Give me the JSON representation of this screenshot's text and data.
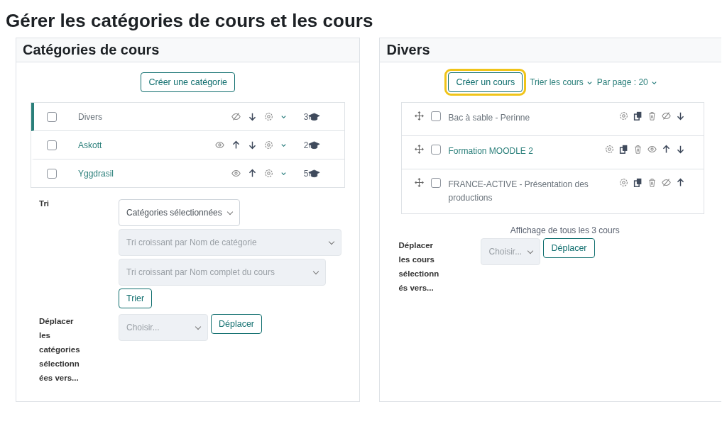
{
  "page_title": "Gérer les catégories de cours et les cours",
  "categories_panel": {
    "title": "Catégories de cours",
    "create_button": "Créer une catégorie",
    "categories": [
      {
        "name": "Divers",
        "checked": false,
        "selected": true,
        "visible": false,
        "move_up": false,
        "move_down": true,
        "count": "3"
      },
      {
        "name": "Askott",
        "checked": false,
        "selected": false,
        "visible": true,
        "move_up": true,
        "move_down": true,
        "count": "2"
      },
      {
        "name": "Yggdrasil",
        "checked": false,
        "selected": false,
        "visible": true,
        "move_up": true,
        "move_down": false,
        "count": "5"
      }
    ],
    "sort_label": "Tri",
    "sort_selects": [
      {
        "value": "Catégories sélectionnées",
        "disabled": false
      },
      {
        "value": "Tri croissant par Nom de catégorie",
        "disabled": true
      },
      {
        "value": "Tri croissant par Nom complet du cours",
        "disabled": true
      }
    ],
    "sort_button": "Trier",
    "move_label": "Déplacer les catégories sélectionnées vers...",
    "move_select": {
      "value": "Choisir...",
      "disabled": true
    },
    "move_button": "Déplacer"
  },
  "courses_panel": {
    "title": "Divers",
    "create_button": {
      "label": "Créer un cours",
      "highlighted": true
    },
    "sort_link": "Trier les cours",
    "per_page_link": "Par page : 20",
    "courses": [
      {
        "name": "Bac à sable - Perinne",
        "checked": false,
        "visible": false,
        "move_up": false,
        "move_down": true
      },
      {
        "name": "Formation MOODLE 2",
        "checked": false,
        "visible": true,
        "move_up": true,
        "move_down": true
      },
      {
        "name": "FRANCE-ACTIVE - Présentation des productions",
        "checked": false,
        "visible": false,
        "move_up": true,
        "move_down": false
      }
    ],
    "listing_info": "Affichage de tous les 3 cours",
    "move_label": "Déplacer les cours sélectionnés vers...",
    "move_select": {
      "value": "Choisir...",
      "disabled": true
    },
    "move_button": "Déplacer"
  }
}
